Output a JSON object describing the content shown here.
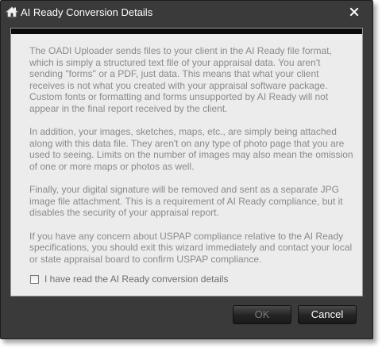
{
  "window": {
    "title": "AI Ready Conversion Details",
    "app_icon": "app-icon",
    "close_icon": "close-icon"
  },
  "content": {
    "paragraphs": [
      "The OADI Uploader sends files to your client in the AI Ready file format, which is simply a structured text file of your appraisal data.  You aren't sending \"forms\" or a PDF, just data.  This means that what your client receives is not what you created with your appraisal software package.  Custom fonts or formatting and forms unsupported by AI Ready will not appear in the final report received by the client.",
      "In addition, your images, sketches, maps, etc., are simply being attached along with this data file.  They aren't on any type of photo page that you are used to seeing.  Limits on the number of images may also mean the omission of one or more maps or photos as well.",
      "Finally, your digital signature will be removed and sent as a separate JPG image file attachment.  This is a requirement of AI Ready compliance, but it disables the security of your appraisal report.",
      "If you have any concern about USPAP compliance relative to the AI Ready specifications, you should exit this wizard immediately and contact your local or state appraisal board to confirm USPAP compliance."
    ],
    "checkbox_label": "I have read the AI Ready conversion details",
    "checkbox_checked": false
  },
  "buttons": {
    "ok_label": "OK",
    "cancel_label": "Cancel"
  },
  "colors": {
    "window_bg": "#3a3a3a",
    "panel_bg": "#ececec",
    "body_text": "#8a8a8a",
    "button_bg": "#1f1f1f"
  }
}
